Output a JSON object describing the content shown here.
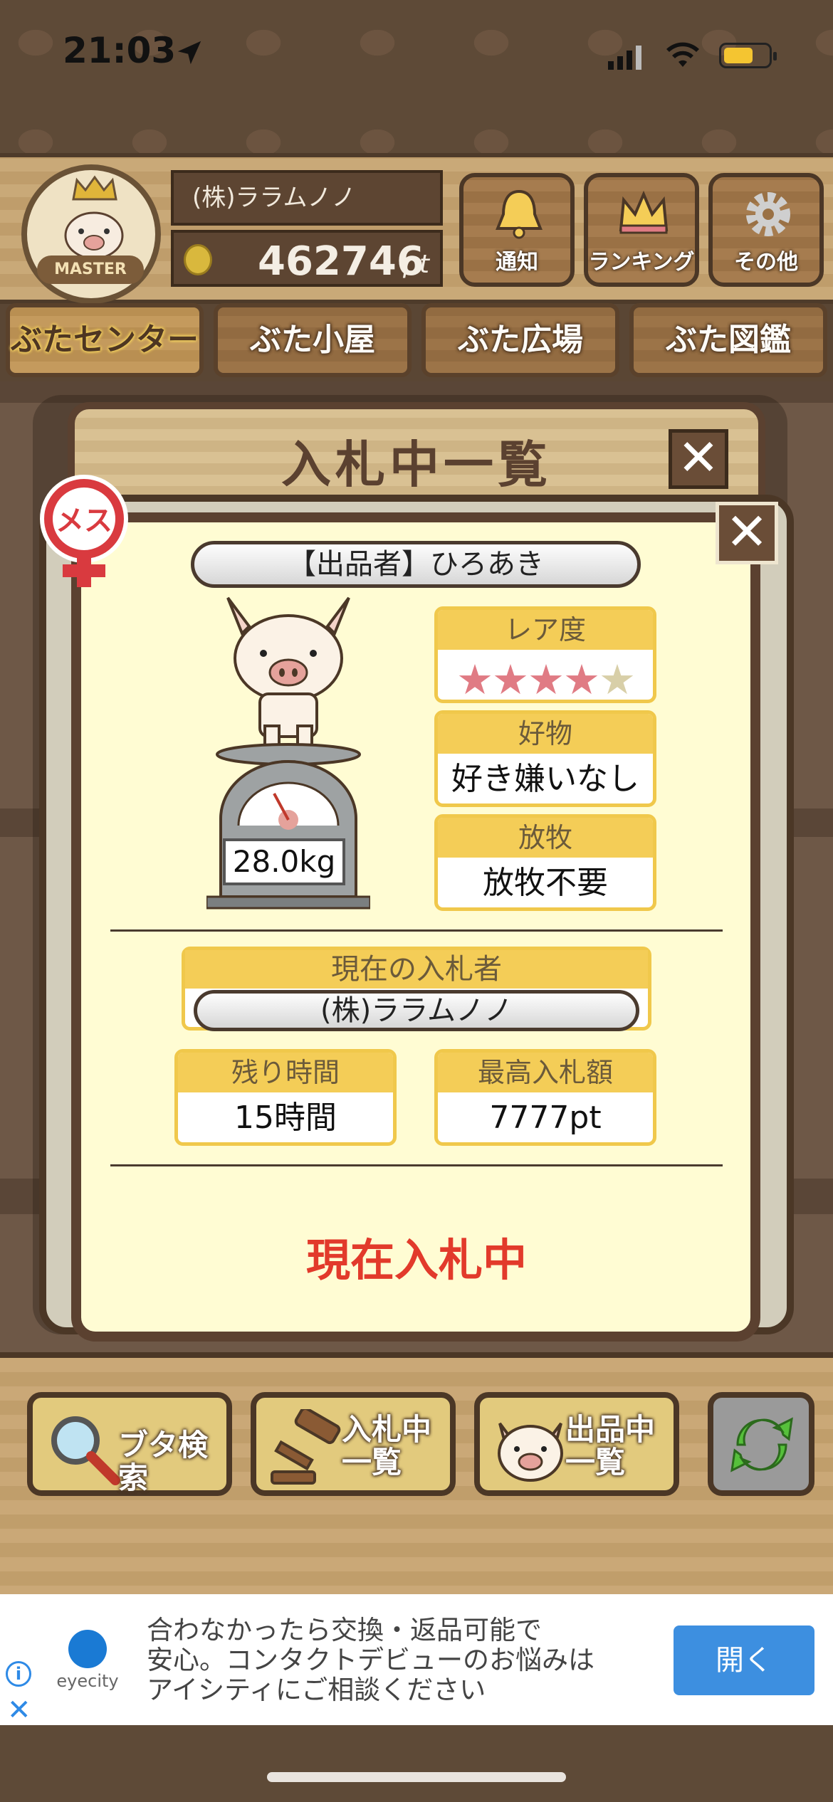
{
  "status_bar": {
    "time": "21:03"
  },
  "header": {
    "badge_text": "MASTER",
    "username": "(株)ララムノノ",
    "points_value": "462746",
    "points_unit": "pt",
    "buttons": [
      {
        "label": "通知",
        "icon": "bell-icon"
      },
      {
        "label": "ランキング",
        "icon": "crown-icon"
      },
      {
        "label": "その他",
        "icon": "gear-icon"
      }
    ]
  },
  "tabs": [
    {
      "label": "ぶたセンター",
      "active": true
    },
    {
      "label": "ぶた小屋"
    },
    {
      "label": "ぶた広場"
    },
    {
      "label": "ぶた図鑑"
    }
  ],
  "dialog": {
    "title": "入札中一覧",
    "close_symbol": "✕",
    "gender_label": "メス",
    "seller": "【出品者】ひろあき",
    "weight": "28.0kg",
    "rarity": {
      "label": "レア度",
      "stars_filled": 4,
      "stars_total": 5
    },
    "favorite": {
      "label": "好物",
      "value": "好き嫌いなし"
    },
    "grazing": {
      "label": "放牧",
      "value": "放牧不要"
    },
    "current_bidder": {
      "label": "現在の入札者",
      "value": "(株)ララムノノ"
    },
    "remaining_time": {
      "label": "残り時間",
      "value": "15時間"
    },
    "highest_bid": {
      "label": "最高入札額",
      "value": "7777pt"
    },
    "status": "現在入札中"
  },
  "bottom_buttons": [
    {
      "line1": "ブタ検索",
      "line2": "",
      "icon": "magnifier-icon"
    },
    {
      "line1": "入札中",
      "line2": "一覧",
      "icon": "gavel-icon"
    },
    {
      "line1": "出品中",
      "line2": "一覧",
      "icon": "pig-icon"
    }
  ],
  "ad": {
    "brand": "eyecity",
    "text_line1": "合わなかったら交換・返品可能で",
    "text_line2": "安心。コンタクトデビューのお悩みは",
    "text_line3": "アイシティにご相談ください",
    "button": "開く"
  },
  "colors": {
    "status_red": "#e23a2b",
    "label_yellow": "#f4cd57",
    "wood_dark": "#5b4130",
    "ad_blue": "#3d8fe0"
  }
}
